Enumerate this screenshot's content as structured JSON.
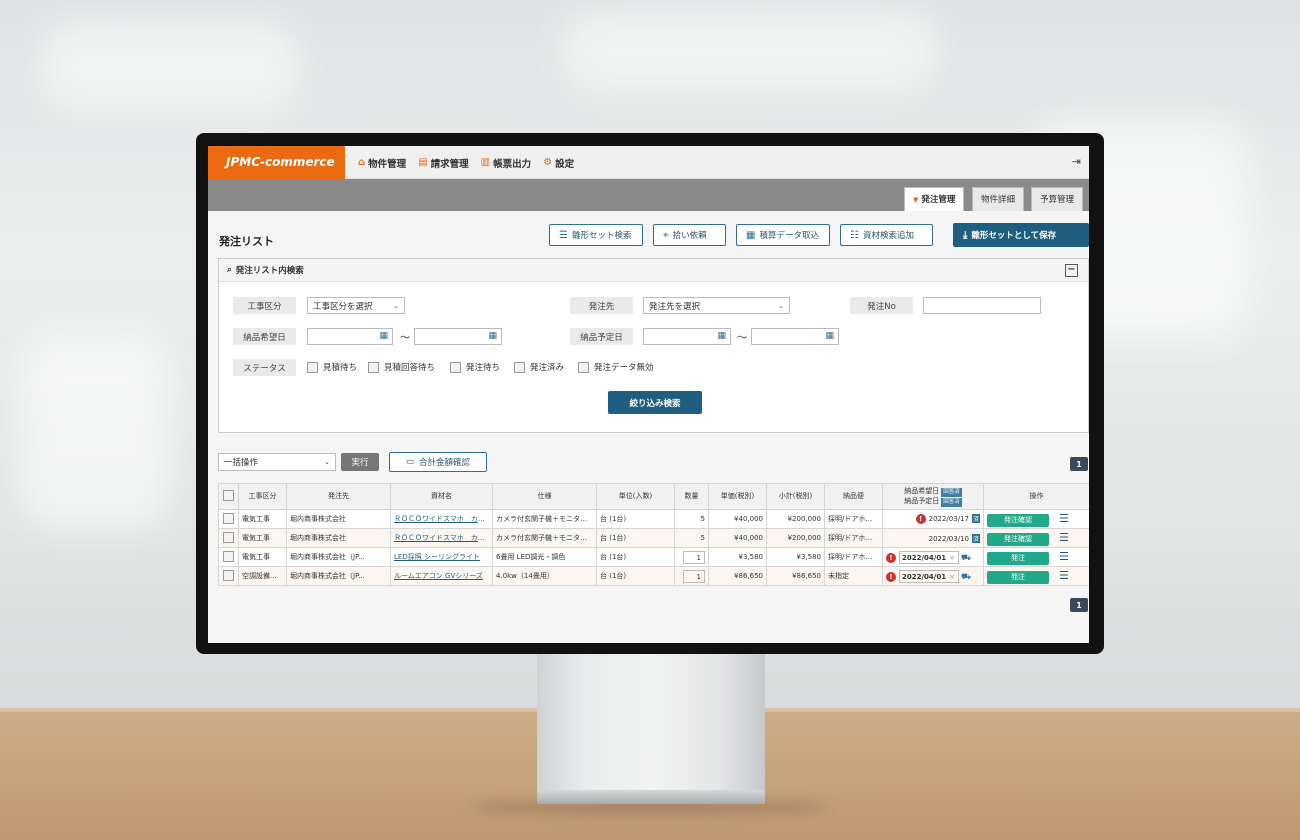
{
  "app": {
    "logo": "JPMC-commerce",
    "nav": [
      {
        "label": "物件管理",
        "icon": "home-icon"
      },
      {
        "label": "請求管理",
        "icon": "invoice-icon"
      },
      {
        "label": "帳票出力",
        "icon": "report-icon"
      },
      {
        "label": "設定",
        "icon": "gear-icon"
      }
    ],
    "tabs": [
      {
        "label": "発注管理",
        "active": true
      },
      {
        "label": "物件詳細",
        "active": false
      },
      {
        "label": "予算管理",
        "active": false
      }
    ]
  },
  "page": {
    "title": "発注リスト",
    "toolbar": {
      "template_search": "雛形セット検索",
      "pickup_request": "拾い依頼",
      "estimate_import": "積算データ取込",
      "material_search_add": "資材検索追加",
      "save_as_template": "雛形セットとして保存"
    }
  },
  "search": {
    "title": "発注リスト内検索",
    "collapse_symbol": "−",
    "construction_type_label": "工事区分",
    "construction_type_value": "工事区分を選択",
    "supplier_label": "発注先",
    "supplier_value": "発注先を選択",
    "order_no_label": "発注No",
    "order_no_value": "",
    "desired_delivery_label": "納品希望日",
    "scheduled_delivery_label": "納品予定日",
    "tilde": "〜",
    "status_label": "ステータス",
    "statuses": [
      "見積待ち",
      "見積回答待ち",
      "発注待ち",
      "発注済み",
      "発注データ無効"
    ],
    "search_button": "絞り込み検索"
  },
  "bulk": {
    "select_value": "一括操作",
    "run_button": "実行",
    "total_button": "合計金額確認",
    "page_number": "1"
  },
  "table": {
    "headers": {
      "construction_type": "工事区分",
      "supplier": "発注先",
      "material": "資材名",
      "spec": "仕様",
      "unit": "単位(入数)",
      "qty": "数量",
      "unit_price": "単価(税別)",
      "subtotal": "小計(税別)",
      "delivery_method": "納品便",
      "desired_date": "納品希望日",
      "desired_tag": "回答済",
      "scheduled_date": "納品予定日",
      "scheduled_tag": "回答済",
      "actions": "操作"
    },
    "rows": [
      {
        "construction_type": "電気工事",
        "supplier": "堀内商事株式会社",
        "material": "ＲＯＣＯワイドスマホ　カメラ...",
        "spec": "カメラ付玄関子機＋モニター...",
        "unit": "台 (1台)",
        "qty": "5",
        "unit_price": "¥40,000",
        "subtotal": "¥200,000",
        "delivery_method": "採明/ドアホン等",
        "date": "2022/03/17",
        "date_icon": "済",
        "action": "発注確認"
      },
      {
        "construction_type": "電気工事",
        "supplier": "堀内商事株式会社",
        "material": "ＲＯＣＯワイドスマホ　カメラ...",
        "spec": "カメラ付玄関子機＋モニター...",
        "unit": "台 (1台)",
        "qty": "5",
        "unit_price": "¥40,000",
        "subtotal": "¥200,000",
        "delivery_method": "採明/ドアホン等",
        "date": "2022/03/10",
        "date_icon": "済",
        "action": "発注確認"
      },
      {
        "construction_type": "電気工事",
        "supplier": "堀内商事株式会社（JP...",
        "material": "LED採照 シーリングライト",
        "spec": "6畳用 LED調光・調色",
        "unit": "台 (1台)",
        "qty": "1",
        "unit_price": "¥3,580",
        "subtotal": "¥3,580",
        "delivery_method": "採明/ドアホン等",
        "date": "2022/04/01",
        "date_clear": "×",
        "action": "発注"
      },
      {
        "construction_type": "空調設備...",
        "supplier": "堀内商事株式会社（JP...",
        "material": "ルームエアコン GVシリーズ",
        "spec": "4.0kw（14畳用）",
        "unit": "台 (1台)",
        "qty": "1",
        "unit_price": "¥86,650",
        "subtotal": "¥86,650",
        "delivery_method": "未指定",
        "date": "2022/04/01",
        "date_clear": "×",
        "action": "発注"
      }
    ]
  },
  "colors": {
    "brand_orange": "#ea6a12",
    "primary_blue": "#1f5e7e",
    "action_green": "#22a98c",
    "warning_red": "#d32f2f"
  }
}
